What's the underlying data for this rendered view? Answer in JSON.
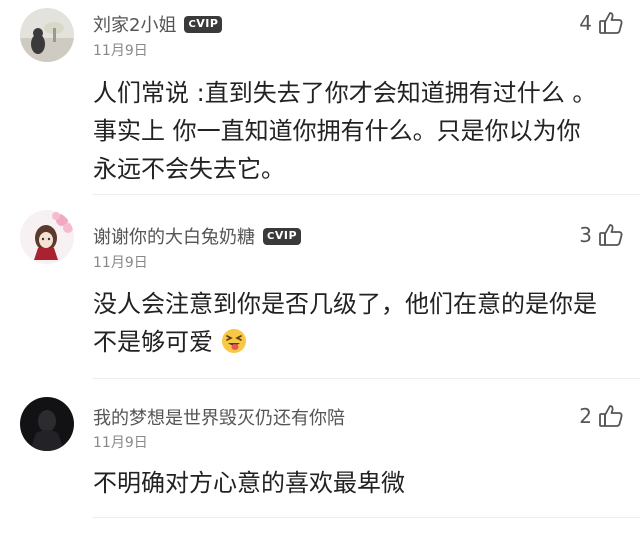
{
  "comments": [
    {
      "user": "刘家2小姐",
      "vip": "VIP",
      "date": "11月9日",
      "likes": "4",
      "lines": [
        "人们常说 :直到失去了你才会知道拥有过什么 。",
        "事实上 你一直知道你拥有什么。只是你以为你",
        "永远不会失去它。"
      ]
    },
    {
      "user": "谢谢你的大白兔奶糖",
      "vip": "VIP",
      "date": "11月9日",
      "likes": "3",
      "lines": [
        "没人会注意到你是否几级了，他们在意的是你是",
        "不是够可爱"
      ],
      "emoji": "squinting-tongue-emoji"
    },
    {
      "user": "我的梦想是世界毁灭仍还有你陪",
      "date": "11月9日",
      "likes": "2",
      "lines": [
        "不明确对方心意的喜欢最卑微"
      ]
    }
  ],
  "icons": {
    "like": "thumbs-up-icon",
    "vip_badge": "vip-badge-icon"
  },
  "colors": {
    "vip_badge_bg": "#3a3a3a",
    "name": "#555555",
    "date": "#888888",
    "text": "#222222"
  }
}
